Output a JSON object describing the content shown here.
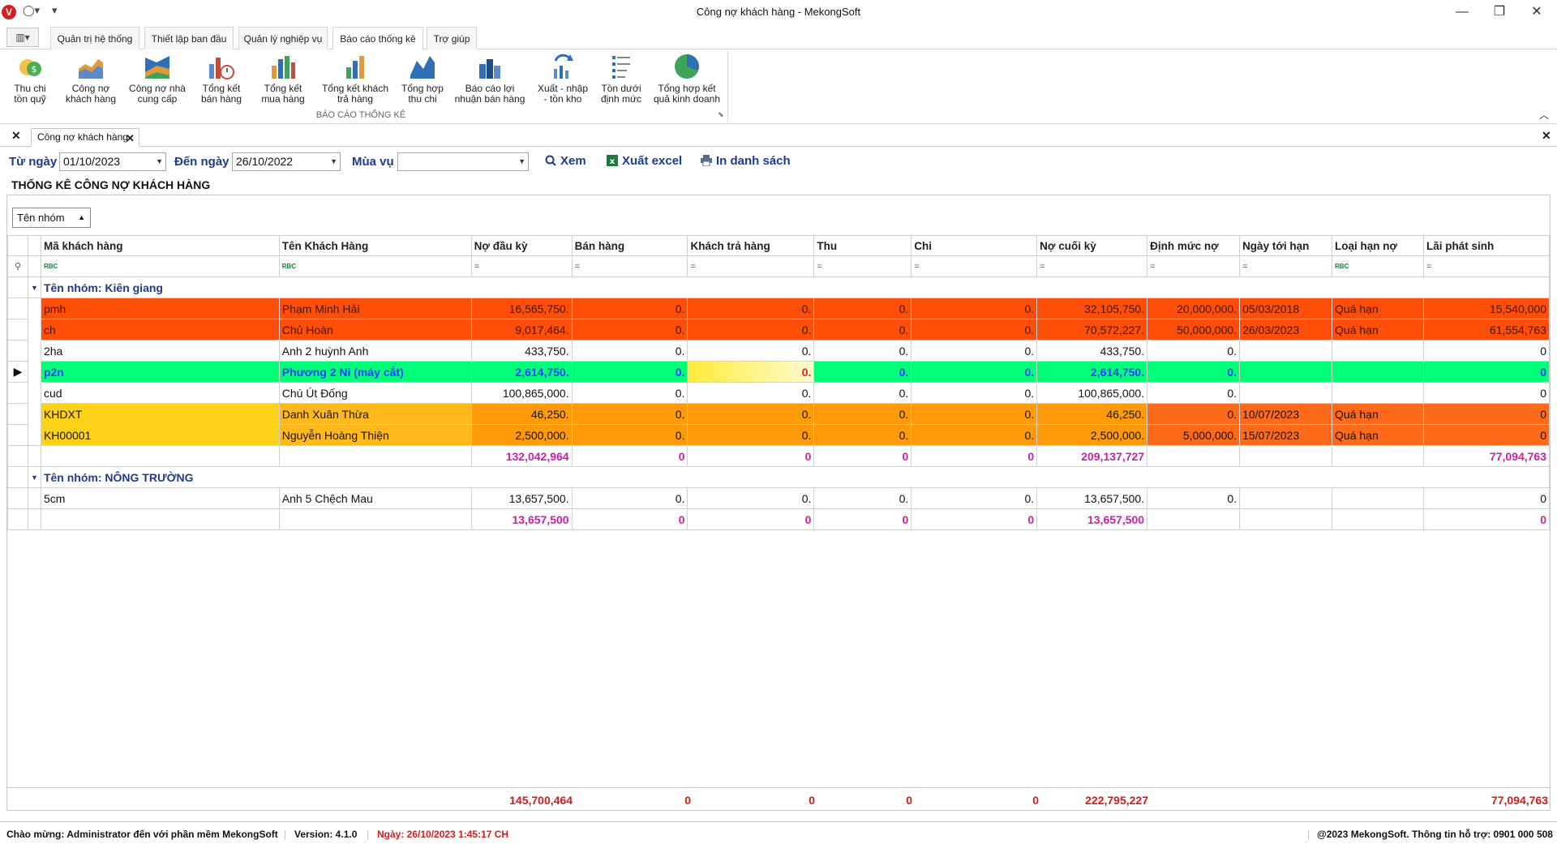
{
  "window": {
    "title": "Công nợ khách hàng - MekongSoft",
    "app_icon": "V",
    "minimize": "—",
    "restore": "❐",
    "close": "✕"
  },
  "ribbon_tabs": [
    {
      "label": "Quản trị hệ thống"
    },
    {
      "label": "Thiết lập ban đầu"
    },
    {
      "label": "Quản lý nghiệp vụ"
    },
    {
      "label": "Báo cáo thống kê"
    },
    {
      "label": "Trợ giúp"
    }
  ],
  "ribbon_buttons": [
    {
      "label": "Thu chi\ntồn quỹ",
      "icon": "cash-icon"
    },
    {
      "label": "Công nợ\nkhách hàng",
      "icon": "area-chart-icon"
    },
    {
      "label": "Công nợ nhà\ncung cấp",
      "icon": "area-chart-icon"
    },
    {
      "label": "Tổng kết\nbán hàng",
      "icon": "bar-clock-icon"
    },
    {
      "label": "Tổng kết\nmua hàng",
      "icon": "bar-chart-icon"
    },
    {
      "label": "Tổng kết khách\ntrả hàng",
      "icon": "bar-chart-icon"
    },
    {
      "label": "Tổng hợp\nthu chi",
      "icon": "line-chart-icon"
    },
    {
      "label": "Báo cáo lợi\nnhuận bán hàng",
      "icon": "bar-chart-icon"
    },
    {
      "label": "Xuất - nhập\n- tồn kho",
      "icon": "refresh-chart-icon"
    },
    {
      "label": "Tồn dưới\nđịnh mức",
      "icon": "list-icon"
    },
    {
      "label": "Tổng hợp kết\nquả kinh doanh",
      "icon": "pie-chart-icon"
    }
  ],
  "ribbon_group_label": "BÁO CÁO THỐNG KÊ",
  "doc_tab": {
    "label": "Công nợ khách hàng"
  },
  "filter": {
    "from_label": "Từ ngày",
    "from_value": "01/10/2023",
    "to_label": "Đến ngày",
    "to_value": "26/10/2022",
    "season_label": "Mùa vụ",
    "season_value": "",
    "view_button": "Xem",
    "export_button": "Xuất excel",
    "print_button": "In danh sách"
  },
  "report_title": "THỐNG KÊ CÔNG NỢ KHÁCH HÀNG",
  "group_chip": "Tên nhóm",
  "columns": [
    "Mã khách hàng",
    "Tên Khách Hàng",
    "Nợ đầu kỳ",
    "Bán hàng",
    "Khách trả hàng",
    "Thu",
    "Chi",
    "Nợ cuối kỳ",
    "Định mức nợ",
    "Ngày tới hạn",
    "Loại hạn nợ",
    "Lãi phát sinh"
  ],
  "filter_row": [
    "RBC",
    "RBC",
    "=",
    "=",
    "=",
    "=",
    "=",
    "=",
    "=",
    "=",
    "RBC",
    "="
  ],
  "groups": [
    {
      "label": "Tên nhóm: Kiên giang",
      "rows": [
        {
          "style": "red",
          "cells": [
            "pmh",
            "Phạm Minh Hải",
            "16,565,750.",
            "0.",
            "0.",
            "0.",
            "0.",
            "32,105,750.",
            "20,000,000.",
            "05/03/2018",
            "Quá hạn",
            "15,540,000"
          ]
        },
        {
          "style": "red",
          "cells": [
            "ch",
            "Chủ Hoàn",
            "9,017,464.",
            "0.",
            "0.",
            "0.",
            "0.",
            "70,572,227.",
            "50,000,000.",
            "26/03/2023",
            "Quá hạn",
            "61,554,763"
          ]
        },
        {
          "style": "plain",
          "cells": [
            "2ha",
            "Anh 2 huỳnh Anh",
            "433,750.",
            "0.",
            "0.",
            "0.",
            "0.",
            "433,750.",
            "0.",
            "",
            "",
            "0"
          ]
        },
        {
          "style": "green",
          "cells": [
            "p2n",
            "Phương 2 Ni (máy cắt)",
            "2,614,750.",
            "0.",
            "0.",
            "0.",
            "0.",
            "2,614,750.",
            "0.",
            "",
            "",
            "0"
          ]
        },
        {
          "style": "plain",
          "cells": [
            "cud",
            "Chú Út Đống",
            "100,865,000.",
            "0.",
            "0.",
            "0.",
            "0.",
            "100,865,000.",
            "0.",
            "",
            "",
            "0"
          ]
        },
        {
          "style": "yellow",
          "cells": [
            "KHDXT",
            "Danh Xuân Thừa",
            "46,250.",
            "0.",
            "0.",
            "0.",
            "0.",
            "46,250.",
            "0.",
            "10/07/2023",
            "Quá hạn",
            "0"
          ]
        },
        {
          "style": "yellow",
          "cells": [
            "KH00001",
            "Nguyễn Hoàng Thiện",
            "2,500,000.",
            "0.",
            "0.",
            "0.",
            "0.",
            "2,500,000.",
            "5,000,000.",
            "15/07/2023",
            "Quá hạn",
            "0"
          ]
        }
      ],
      "summary": [
        "",
        "",
        "132,042,964",
        "0",
        "0",
        "0",
        "0",
        "209,137,727",
        "",
        "",
        "",
        "77,094,763"
      ]
    },
    {
      "label": "Tên nhóm: NÔNG TRƯỜNG",
      "rows": [
        {
          "style": "plain",
          "cells": [
            "5cm",
            "Anh 5 Chệch Mau",
            "13,657,500.",
            "0.",
            "0.",
            "0.",
            "0.",
            "13,657,500.",
            "0.",
            "",
            "",
            "0"
          ]
        }
      ],
      "summary": [
        "",
        "",
        "13,657,500",
        "0",
        "0",
        "0",
        "0",
        "13,657,500",
        "",
        "",
        "",
        "0"
      ]
    }
  ],
  "totals": {
    "no_dau_ky": "145,700,464",
    "ban_hang": "0",
    "khach_tra": "0",
    "thu": "0",
    "chi": "0",
    "no_cuoi_ky": "222,795,227",
    "lai": "77,094,763"
  },
  "status": {
    "welcome": "Chào mừng: Administrator đến với phần mềm MekongSoft",
    "version": "Version: 4.1.0",
    "date": "Ngày: 26/10/2023 1:45:17 CH",
    "support": "@2023 MekongSoft. Thông tin hỗ trợ: 0901 000 508"
  },
  "colors": {
    "accent": "#1f3c8c",
    "overdue": "#ff4d0a",
    "selected_row": "#00ff77",
    "near_due": "#ff9b0a",
    "summary_text": "#cc1fa6",
    "total_text": "#d41b1b"
  }
}
